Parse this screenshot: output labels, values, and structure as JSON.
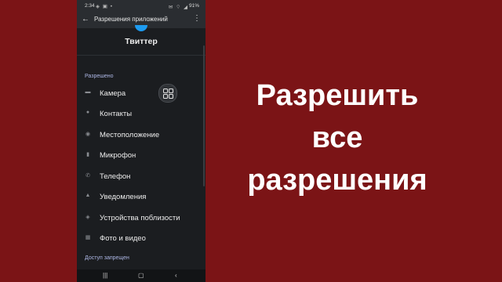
{
  "status_bar": {
    "time": "2:34",
    "left_icons": "◈ ▣ •",
    "right_icons": "✉ ⌔ ◢",
    "battery": "91%"
  },
  "top_bar": {
    "back_icon": "arrow-left-icon",
    "title": "Разрешения приложений",
    "menu_icon": "more-vertical-icon"
  },
  "app": {
    "name": "Твиттер",
    "accent_color": "#1d9bf0"
  },
  "allowed_section": {
    "label": "Разрешено",
    "items": [
      {
        "label": "Камера",
        "icon": "camera-icon"
      },
      {
        "label": "Контакты",
        "icon": "contacts-icon"
      },
      {
        "label": "Местоположение",
        "icon": "location-icon"
      },
      {
        "label": "Микрофон",
        "icon": "microphone-icon"
      },
      {
        "label": "Телефон",
        "icon": "phone-icon"
      },
      {
        "label": "Уведомления",
        "icon": "bell-icon"
      },
      {
        "label": "Устройства поблизости",
        "icon": "nearby-devices-icon"
      },
      {
        "label": "Фото и видео",
        "icon": "photos-icon"
      }
    ]
  },
  "denied_section": {
    "label": "Доступ запрещен"
  },
  "headline": {
    "line1": "Разрешить все",
    "line2": "разрешения"
  },
  "colors": {
    "background": "#7b1416",
    "phone_bg": "#1b1d20",
    "section_label": "#aeb8e6"
  }
}
